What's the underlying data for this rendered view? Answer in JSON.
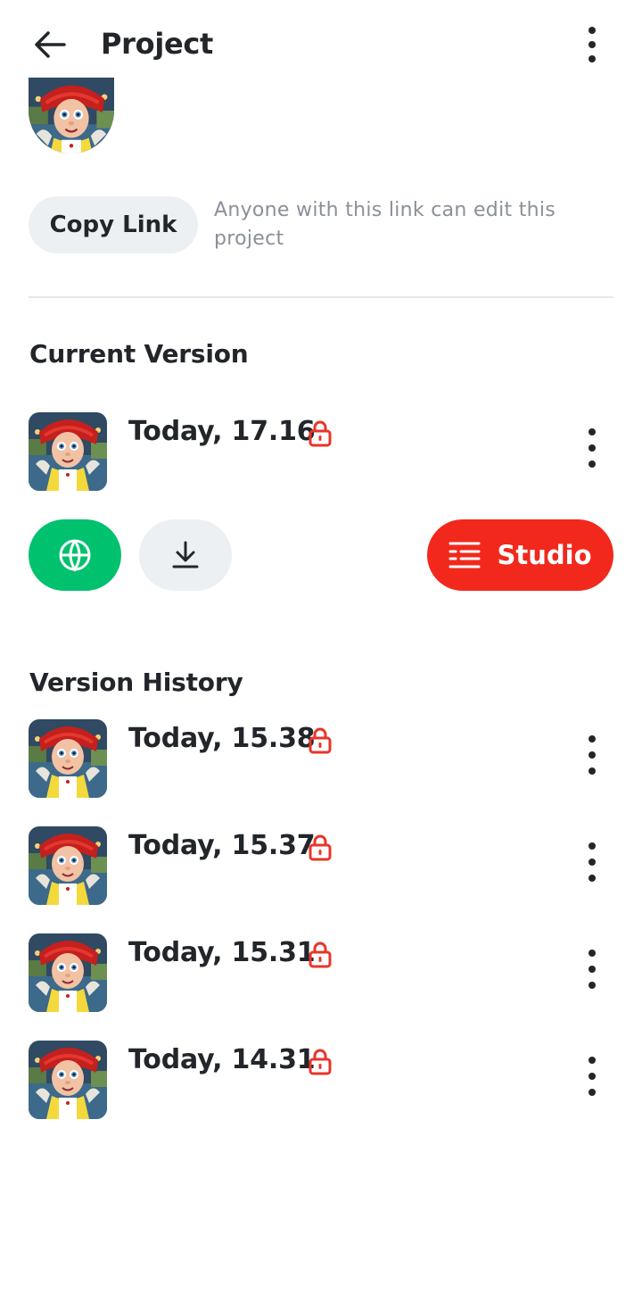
{
  "header": {
    "title": "Project",
    "back_icon": "arrow-left-icon",
    "menu_icon": "more-vertical-icon"
  },
  "share": {
    "copy_link_label": "Copy Link",
    "hint": "Anyone with this link can edit this project"
  },
  "current_version": {
    "section_title": "Current Version",
    "time": "Today, 17.16",
    "lock_icon": "lock-icon",
    "actions": {
      "publish_icon": "globe-icon",
      "download_icon": "download-icon",
      "studio_label": "Studio",
      "studio_icon": "list-indent-icon"
    }
  },
  "version_history": {
    "section_title": "Version History",
    "items": [
      {
        "time": "Today, 15.38"
      },
      {
        "time": "Today, 15.37"
      },
      {
        "time": "Today, 15.31"
      },
      {
        "time": "Today, 14.31"
      }
    ]
  },
  "colors": {
    "text": "#22262b",
    "muted": "#8a9099",
    "accent_red": "#f2281c",
    "publish_green": "#00c16e",
    "chip_grey": "#edf0f3",
    "lock_red": "#e8352a"
  }
}
